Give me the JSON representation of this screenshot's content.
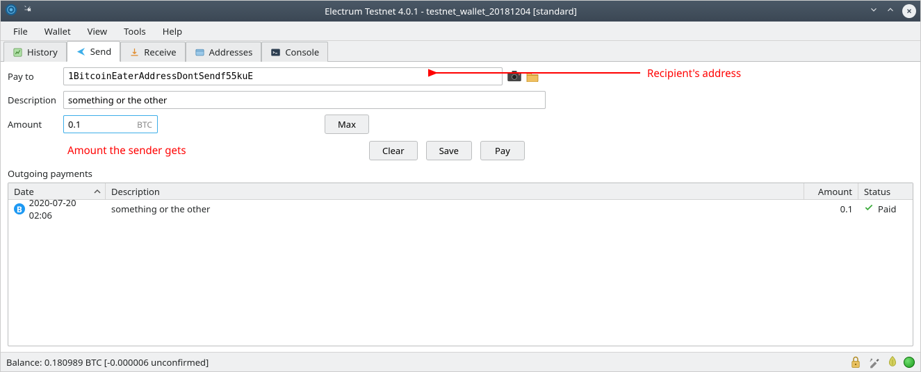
{
  "window": {
    "title": "Electrum Testnet 4.0.1 - testnet_wallet_20181204 [standard]"
  },
  "menu": {
    "file": "File",
    "wallet": "Wallet",
    "view": "View",
    "tools": "Tools",
    "help": "Help"
  },
  "tabs": {
    "history": "History",
    "send": "Send",
    "receive": "Receive",
    "addresses": "Addresses",
    "console": "Console"
  },
  "form": {
    "payto_label": "Pay to",
    "payto_value": "1BitcoinEaterAddressDontSendf55kuE",
    "description_label": "Description",
    "description_value": "something or the other",
    "amount_label": "Amount",
    "amount_value": "0.1",
    "amount_unit": "BTC",
    "max": "Max",
    "clear": "Clear",
    "save": "Save",
    "pay": "Pay"
  },
  "annotations": {
    "recipient": "Recipient's address",
    "amount": "Amount the sender gets"
  },
  "outgoing": {
    "label": "Outgoing payments",
    "cols": {
      "date": "Date",
      "description": "Description",
      "amount": "Amount",
      "status": "Status"
    },
    "rows": [
      {
        "date": "2020-07-20 02:06",
        "description": "something or the other",
        "amount": "0.1",
        "status": "Paid"
      }
    ]
  },
  "status": {
    "balance": "Balance: 0.180989 BTC  [-0.000006 unconfirmed]"
  }
}
